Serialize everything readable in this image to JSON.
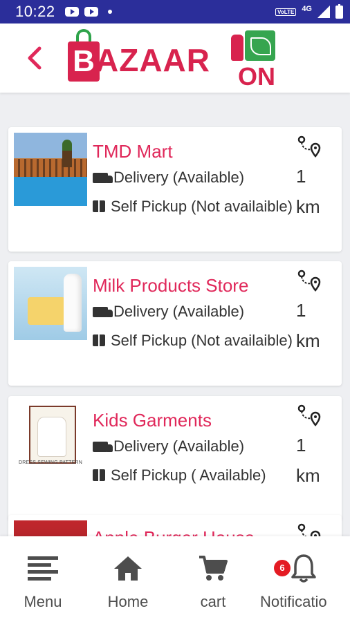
{
  "status_bar": {
    "time": "10:22",
    "volte_label": "VoLTE",
    "network_label": "4G"
  },
  "header": {
    "logo_text_main": "AZAAR",
    "logo_letter_b": "B",
    "logo_text_on": "ON"
  },
  "stores": [
    {
      "name": "TMD Mart",
      "delivery": "Delivery (Available)",
      "pickup": "Self Pickup (Not availaible)",
      "distance_value": "1",
      "distance_unit": "km"
    },
    {
      "name": "Milk Products Store",
      "delivery": "Delivery (Available)",
      "pickup": "Self Pickup (Not availaible)",
      "distance_value": "1",
      "distance_unit": "km"
    },
    {
      "name": "Kids Garments",
      "delivery": "Delivery (Available)",
      "pickup": "Self Pickup ( Available)",
      "distance_value": "1",
      "distance_unit": "km",
      "thumb_caption": "DRESS SEWING PATTERN"
    },
    {
      "name": "Apple Burger House"
    }
  ],
  "bottom_nav": {
    "menu": "Menu",
    "home": "Home",
    "cart": "cart",
    "notifications": "Notificatio",
    "notification_count": "6"
  },
  "colors": {
    "status_bar": "#2b2e9a",
    "accent": "#e0285a",
    "badge": "#e41b23",
    "background": "#eeeff2"
  }
}
